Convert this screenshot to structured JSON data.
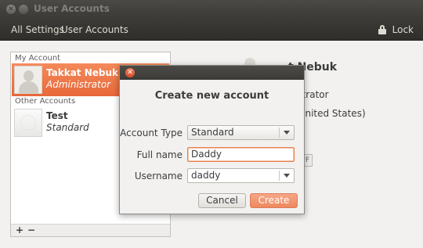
{
  "window": {
    "title": "User Accounts"
  },
  "toolbar": {
    "all_settings": "All Settings",
    "current": "User Accounts",
    "lock_label": "Lock"
  },
  "panel": {
    "my_account_label": "My Account",
    "other_accounts_label": "Other Accounts",
    "accounts": [
      {
        "name": "Takkat Nebuk",
        "role": "Administrator",
        "selected": true
      },
      {
        "name": "Test",
        "role": "Standard",
        "selected": false
      }
    ],
    "add_label": "+",
    "remove_label": "−"
  },
  "details": {
    "name_fragment": "t Nebuk",
    "type_fragment": "istrator",
    "language_fragment": "(United States)",
    "switch_fragment": "FF"
  },
  "dialog": {
    "title": "Create new account",
    "account_type_label": "Account Type",
    "account_type_value": "Standard",
    "full_name_label": "Full name",
    "full_name_value": "Daddy",
    "username_label": "Username",
    "username_value": "daddy",
    "cancel_label": "Cancel",
    "create_label": "Create"
  },
  "colors": {
    "accent": "#ee8860",
    "selection": "#f07746",
    "titlebar": "#3c3b37"
  }
}
